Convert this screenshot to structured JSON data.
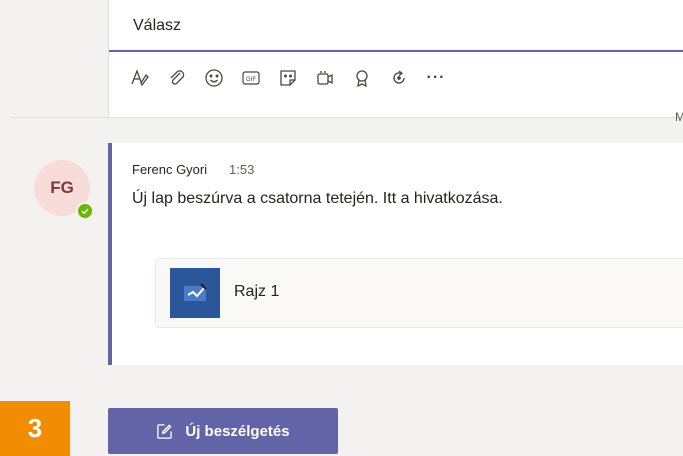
{
  "reply": {
    "placeholder": "Válasz"
  },
  "toolbar": {
    "items": [
      {
        "name": "format-icon"
      },
      {
        "name": "attach-icon"
      },
      {
        "name": "emoji-icon"
      },
      {
        "name": "gif-icon",
        "label": "GIF"
      },
      {
        "name": "sticker-icon"
      },
      {
        "name": "meet-icon"
      },
      {
        "name": "praise-icon"
      },
      {
        "name": "loop-icon"
      },
      {
        "name": "more-icon",
        "label": "···"
      }
    ]
  },
  "divider": {
    "letter": "M"
  },
  "message": {
    "initials": "FG",
    "author": "Ferenc Gyori",
    "time": "1:53",
    "text": "Új lap beszúrva a csatorna tetején. Itt a hivatkozása.",
    "attachment": {
      "name": "Rajz 1",
      "icon": "whiteboard-icon"
    },
    "presence": "available"
  },
  "step": {
    "number": "3"
  },
  "new_conversation": {
    "label": "Új beszélgetés",
    "icon": "compose-icon"
  },
  "colors": {
    "accent": "#6264a7",
    "badge": "#f28c00",
    "avatar_bg": "#f8dcd9",
    "presence": "#6bb700",
    "attachment_icon": "#2b579a"
  }
}
